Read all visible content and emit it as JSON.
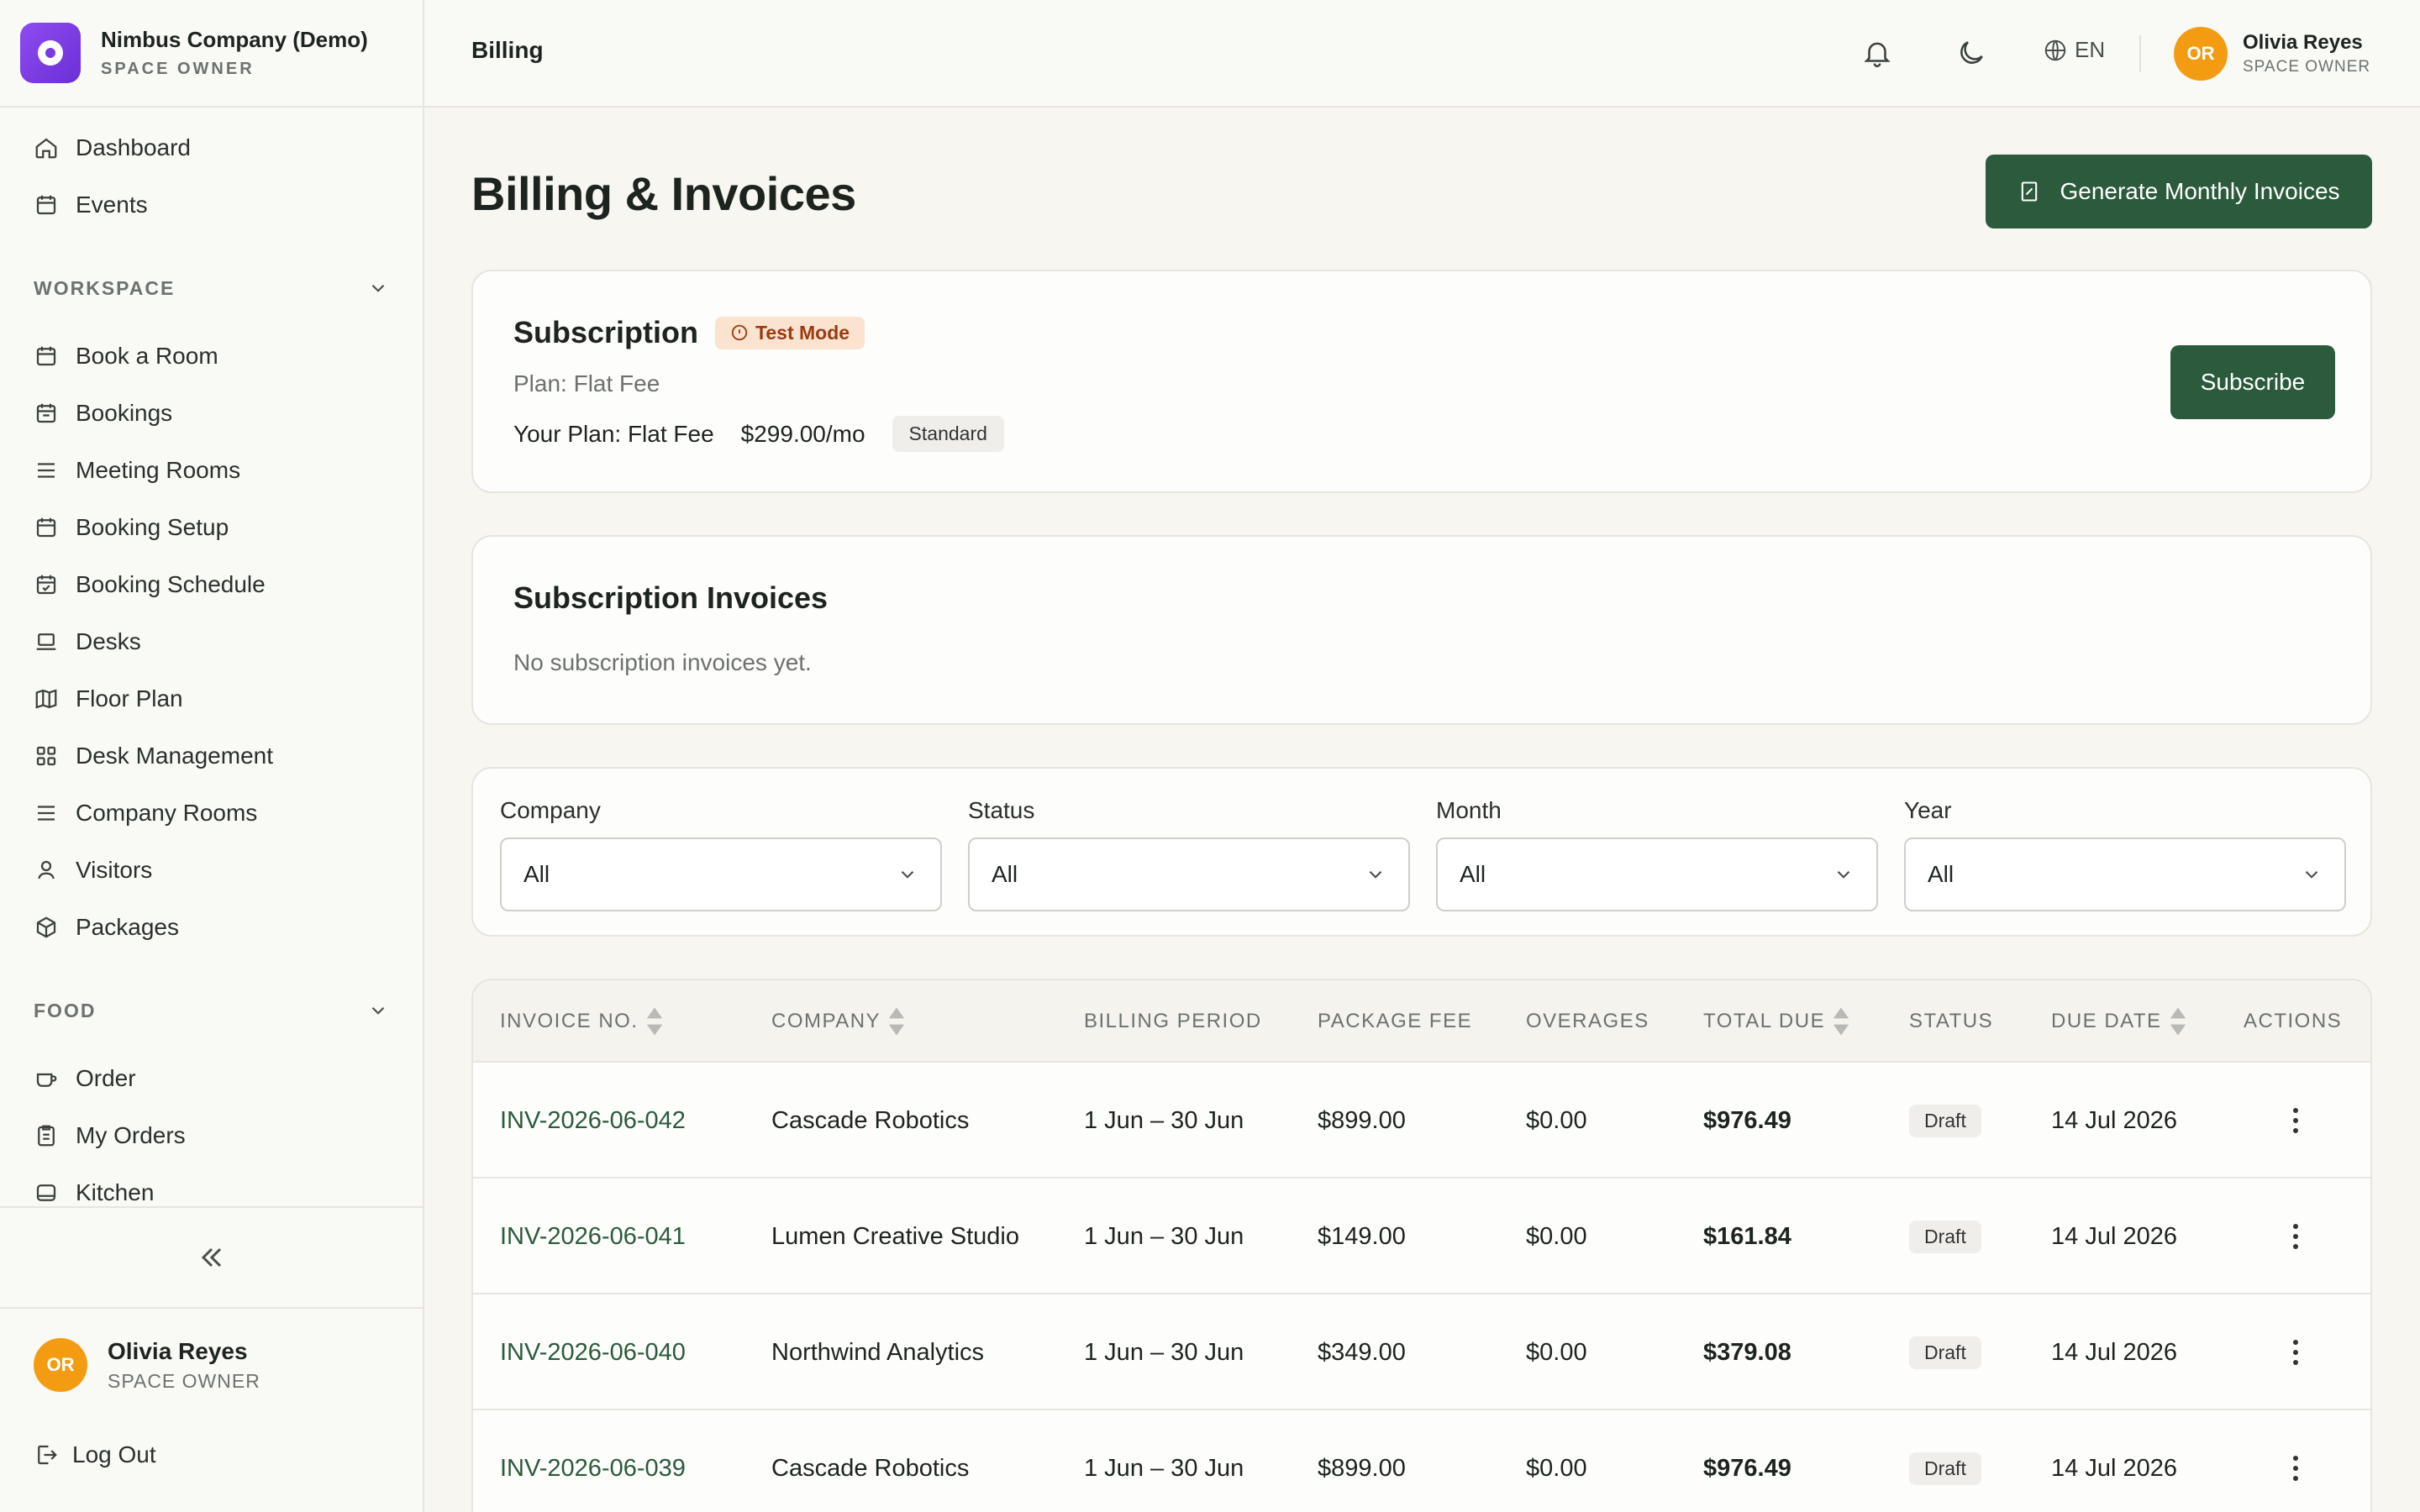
{
  "sidebar": {
    "org_name": "Nimbus Company (Demo)",
    "org_role": "SPACE OWNER",
    "top_items": [
      {
        "label": "Dashboard",
        "icon": "home-icon"
      },
      {
        "label": "Events",
        "icon": "calendar-icon"
      }
    ],
    "workspace_heading": "WORKSPACE",
    "workspace_items": [
      {
        "label": "Book a Room",
        "icon": "calendar-icon"
      },
      {
        "label": "Bookings",
        "icon": "calendar-icon"
      },
      {
        "label": "Meeting Rooms",
        "icon": "list-icon"
      },
      {
        "label": "Booking Setup",
        "icon": "calendar-icon"
      },
      {
        "label": "Booking Schedule",
        "icon": "calendar-check-icon"
      },
      {
        "label": "Desks",
        "icon": "laptop-icon"
      },
      {
        "label": "Floor Plan",
        "icon": "map-icon"
      },
      {
        "label": "Desk Management",
        "icon": "grid-icon"
      },
      {
        "label": "Company Rooms",
        "icon": "list-icon"
      },
      {
        "label": "Visitors",
        "icon": "user-icon"
      },
      {
        "label": "Packages",
        "icon": "package-icon"
      }
    ],
    "food_heading": "FOOD",
    "food_items": [
      {
        "label": "Order",
        "icon": "cup-icon"
      },
      {
        "label": "My Orders",
        "icon": "clipboard-icon"
      },
      {
        "label": "Kitchen",
        "icon": "kitchen-icon"
      }
    ],
    "user": {
      "initials": "OR",
      "name": "Olivia Reyes",
      "role": "SPACE OWNER"
    },
    "logout_label": "Log Out"
  },
  "topbar": {
    "title": "Billing",
    "language": "EN",
    "user": {
      "initials": "OR",
      "name": "Olivia Reyes",
      "role": "SPACE OWNER"
    }
  },
  "page": {
    "title": "Billing & Invoices",
    "generate_button": "Generate Monthly Invoices"
  },
  "subscription": {
    "heading": "Subscription",
    "mode_badge": "Test Mode",
    "plan_line": "Plan: Flat Fee",
    "your_plan": "Your Plan: Flat Fee",
    "price": "$299.00/mo",
    "tier": "Standard",
    "subscribe_button": "Subscribe"
  },
  "subscription_invoices": {
    "heading": "Subscription Invoices",
    "empty_text": "No subscription invoices yet."
  },
  "filters": [
    {
      "label": "Company",
      "value": "All"
    },
    {
      "label": "Status",
      "value": "All"
    },
    {
      "label": "Month",
      "value": "All"
    },
    {
      "label": "Year",
      "value": "All"
    }
  ],
  "table": {
    "columns": [
      "INVOICE NO.",
      "COMPANY",
      "BILLING PERIOD",
      "PACKAGE FEE",
      "OVERAGES",
      "TOTAL DUE",
      "STATUS",
      "DUE DATE",
      "ACTIONS"
    ],
    "rows": [
      {
        "invoice": "INV-2026-06-042",
        "company": "Cascade Robotics",
        "period": "1 Jun – 30 Jun",
        "fee": "$899.00",
        "overages": "$0.00",
        "total": "$976.49",
        "status": "Draft",
        "due": "14 Jul 2026"
      },
      {
        "invoice": "INV-2026-06-041",
        "company": "Lumen Creative Studio",
        "period": "1 Jun – 30 Jun",
        "fee": "$149.00",
        "overages": "$0.00",
        "total": "$161.84",
        "status": "Draft",
        "due": "14 Jul 2026"
      },
      {
        "invoice": "INV-2026-06-040",
        "company": "Northwind Analytics",
        "period": "1 Jun – 30 Jun",
        "fee": "$349.00",
        "overages": "$0.00",
        "total": "$379.08",
        "status": "Draft",
        "due": "14 Jul 2026"
      },
      {
        "invoice": "INV-2026-06-039",
        "company": "Cascade Robotics",
        "period": "1 Jun – 30 Jun",
        "fee": "$899.00",
        "overages": "$0.00",
        "total": "$976.49",
        "status": "Draft",
        "due": "14 Jul 2026"
      }
    ]
  },
  "colors": {
    "accent": "#2b5a3c",
    "avatar": "#f39c12",
    "brand": "#7a3ae2"
  }
}
